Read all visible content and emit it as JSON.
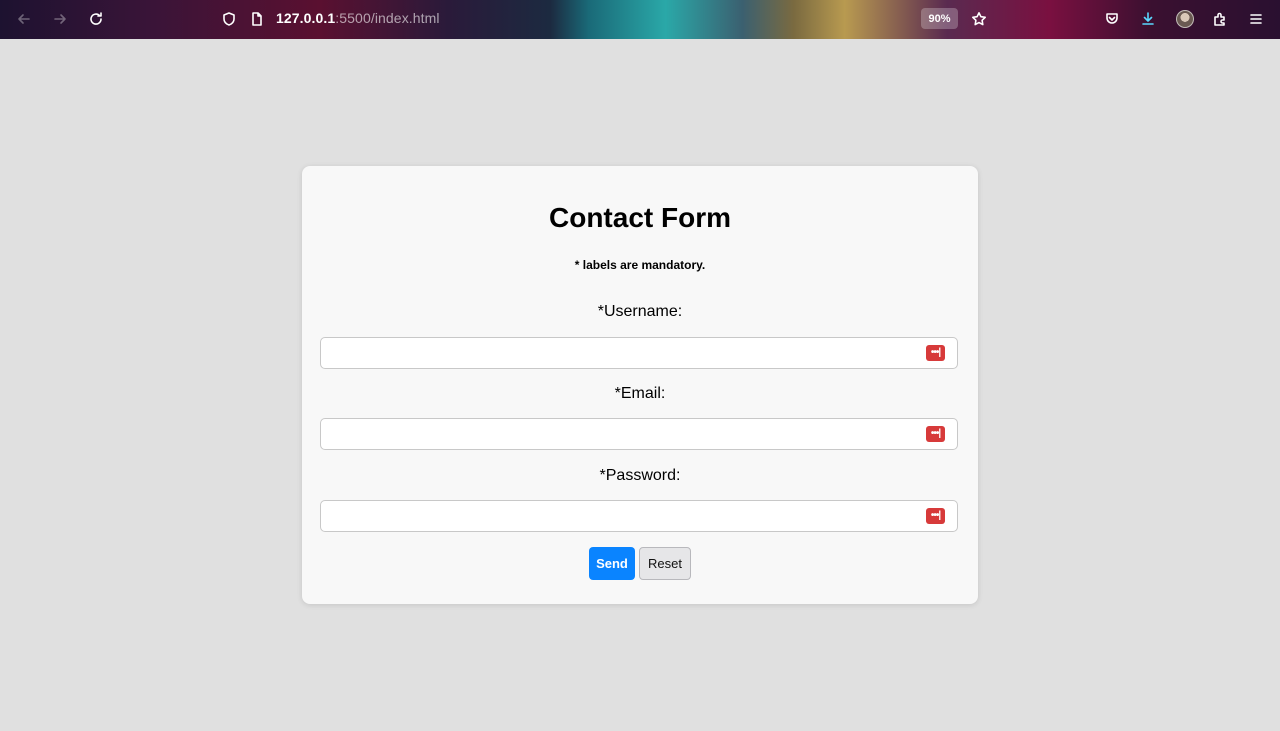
{
  "browser": {
    "url_host": "127.0.0.1",
    "url_rest": ":5500/index.html",
    "zoom": "90%",
    "icons": [
      "back-icon",
      "forward-icon",
      "reload-icon",
      "shield-icon",
      "page-icon",
      "bookmark-star-icon",
      "pocket-icon",
      "download-icon",
      "avatar",
      "extensions-icon",
      "menu-icon"
    ]
  },
  "form": {
    "title": "Contact Form",
    "note": "* labels are mandatory.",
    "fields": [
      {
        "label": "*Username:",
        "value": ""
      },
      {
        "label": "*Email:",
        "value": ""
      },
      {
        "label": "*Password:",
        "value": ""
      }
    ],
    "password_manager_glyph": "•••|",
    "send_label": "Send",
    "reset_label": "Reset"
  },
  "colors": {
    "page_bg": "#e0e0e0",
    "card_bg": "#f8f8f8",
    "send_button": "#0a84ff",
    "password_icon": "#d73a3a"
  }
}
